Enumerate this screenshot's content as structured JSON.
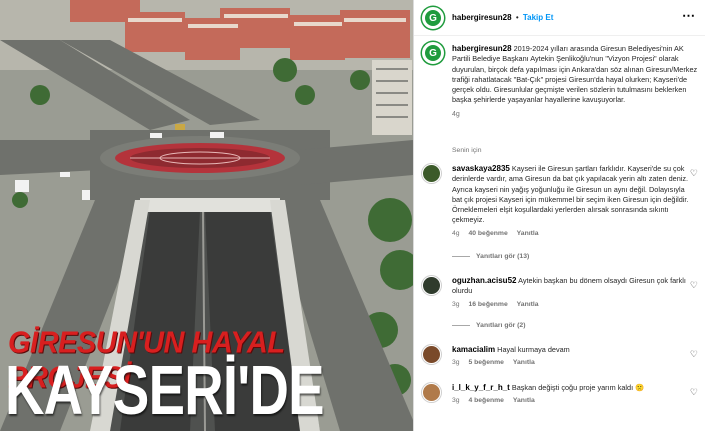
{
  "media": {
    "overlay_title": "GİRESUN'UN HAYAL PROJESİ",
    "overlay_city": "KAYSERİ'DE"
  },
  "post": {
    "username": "habergiresun28",
    "follow_label": "Takip Et",
    "more_icon": "more-horizontal-icon",
    "caption": "2019-2024 yılları arasında Giresun Belediyesi'nin AK Partili Belediye Başkanı Aytekin Şenlikoğlu'nun \"Vizyon Projesi\" olarak duyurulan, birçok defa yapılması için Ankara'dan söz alınan Giresun/Merkez trafiği rahatlatacak \"Bat-Çık\" projesi Giresun'da hayal olurken; Kayseri'de gerçek oldu. Giresunlular geçmişte verilen sözlerin tutulmasını beklerken başka şehirlerde yaşayanlar hayallerine kavuşuyorlar.",
    "time": "4g",
    "see_translation": "Senin için",
    "avatar_letter": "G"
  },
  "comments": [
    {
      "username": "savaskaya2835",
      "text": "Kayseri ile Giresun şartları farklıdır. Kayseri'de su çok derinlerde vardır, ama Giresun da bat çık yapılacak yerin altı zaten deniz. Ayrıca kayseri nin yağış yoğunluğu ile Giresun un aynı değil. Dolayısıyla bat çık projesi Kayseri için mükemmel bir seçim iken Giresun için değildir. Örneklemeleri elşit koşullardaki yerlerden alırsak sonrasında sıkıntı çekmeyiz.",
      "time": "4g",
      "likes": "40 beğenme",
      "reply": "Yanıtla",
      "replies_label": "Yanıtları gör (13)",
      "avatar_color": "#3c5a2a"
    },
    {
      "username": "oguzhan.acisu52",
      "text": "Aytekin başkan bu dönem olsaydı Giresun çok farklı olurdu",
      "time": "3g",
      "likes": "16 beğenme",
      "reply": "Yanıtla",
      "replies_label": "Yanıtları gör (2)",
      "avatar_color": "#2f3b2c"
    },
    {
      "username": "kamacialim",
      "text": "Hayal kurmaya devam",
      "time": "3g",
      "likes": "5 beğenme",
      "reply": "Yanıtla",
      "avatar_color": "#7a4a2a"
    },
    {
      "username": "i_l_k_y_f_r_h_t",
      "text": "Başkan değişti çoğu proje yarım kaldı 🙁",
      "time": "3g",
      "likes": "4 beğenme",
      "reply": "Yanıtla",
      "avatar_color": "#b07a4a"
    }
  ],
  "colors": {
    "accent": "#0095f6",
    "brand_green": "#1f9b3d",
    "overlay_red": "#d81f1f"
  }
}
